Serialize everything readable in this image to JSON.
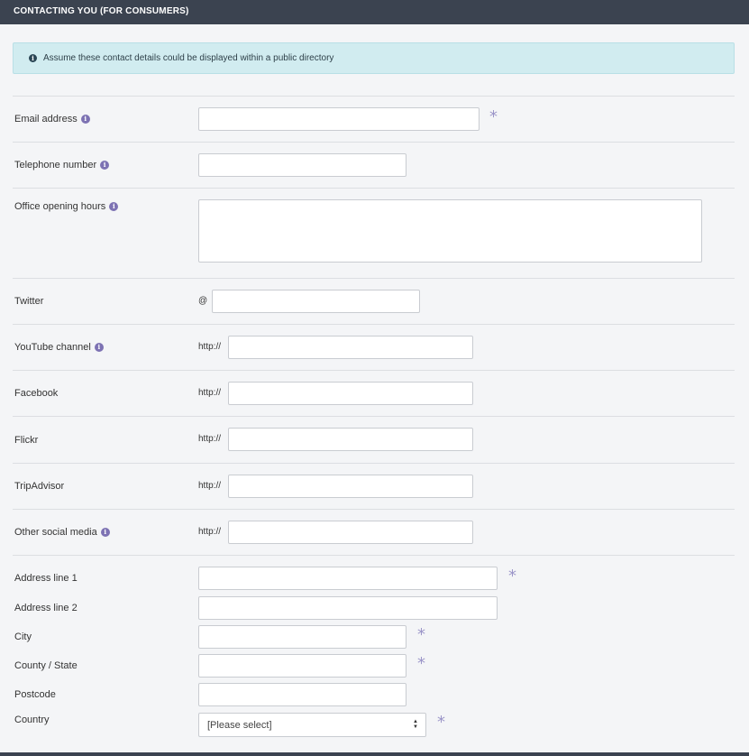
{
  "header": {
    "title": "CONTACTING YOU (FOR CONSUMERS)"
  },
  "notice": {
    "icon": "info-icon",
    "text": "Assume these contact details could be displayed within a public directory"
  },
  "fields": {
    "email": {
      "label": "Email address",
      "value": "",
      "required_mark": "*"
    },
    "telephone": {
      "label": "Telephone number",
      "value": ""
    },
    "office_hours": {
      "label": "Office opening hours",
      "value": ""
    },
    "twitter": {
      "label": "Twitter",
      "prefix": "@",
      "value": ""
    },
    "youtube": {
      "label": "YouTube channel",
      "prefix": "http://",
      "value": ""
    },
    "facebook": {
      "label": "Facebook",
      "prefix": "http://",
      "value": ""
    },
    "flickr": {
      "label": "Flickr",
      "prefix": "http://",
      "value": ""
    },
    "tripadvisor": {
      "label": "TripAdvisor",
      "prefix": "http://",
      "value": ""
    },
    "other_social": {
      "label": "Other social media",
      "prefix": "http://",
      "value": ""
    }
  },
  "address": {
    "line1": {
      "label": "Address line 1",
      "value": "",
      "required_mark": "*"
    },
    "line2": {
      "label": "Address line 2",
      "value": ""
    },
    "city": {
      "label": "City",
      "value": "",
      "required_mark": "*"
    },
    "county": {
      "label": "County / State",
      "value": "",
      "required_mark": "*"
    },
    "postcode": {
      "label": "Postcode",
      "value": ""
    },
    "country": {
      "label": "Country",
      "selected": "[Please select]",
      "required_mark": "*"
    }
  },
  "help_icon": "i",
  "colors": {
    "header_bg": "#3b4350",
    "notice_bg": "#d1ecf0",
    "help_icon": "#7d72b3",
    "required_mark": "#9b95c8"
  }
}
